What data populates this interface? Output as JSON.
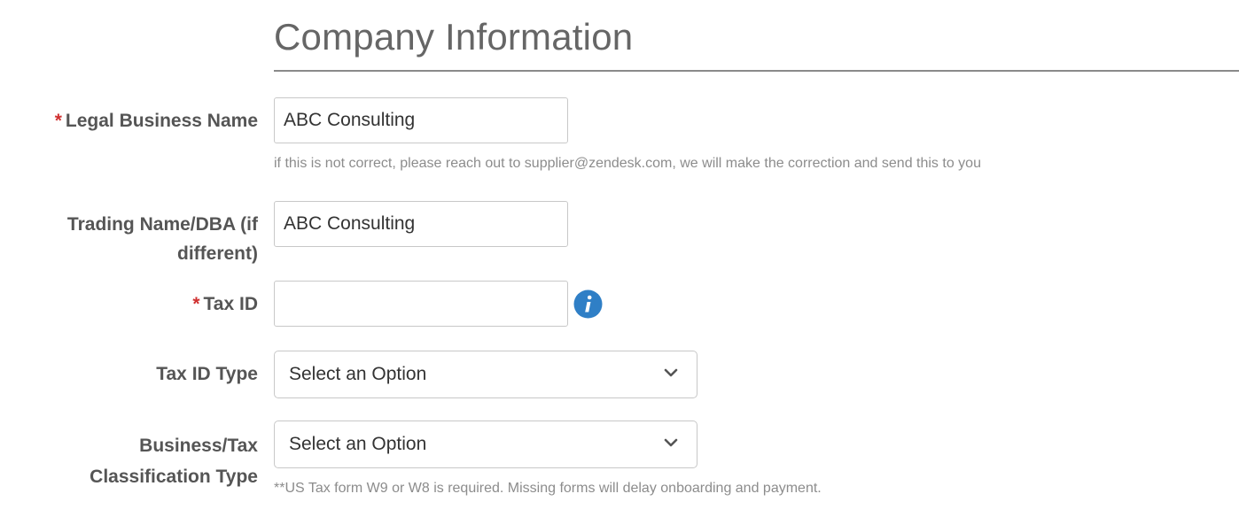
{
  "section": {
    "title": "Company Information"
  },
  "fields": {
    "legal_business_name": {
      "required_marker": "*",
      "label": "Legal Business Name",
      "value": "ABC Consulting",
      "help": "if this is not correct, please reach out to supplier@zendesk.com, we will make the correction and send this to you"
    },
    "trading_name": {
      "label_line1": "Trading Name/DBA (if",
      "label_line2": "different)",
      "value": "ABC Consulting"
    },
    "tax_id": {
      "required_marker": "*",
      "label": "Tax ID",
      "value": "",
      "info_icon": "info-icon"
    },
    "tax_id_type": {
      "label": "Tax ID Type",
      "selected": "Select an Option"
    },
    "business_tax_classification": {
      "label_line1": "Business/Tax",
      "label_line2": "Classification Type",
      "selected": "Select an Option",
      "help": "**US Tax form W9 or W8 is required. Missing forms will delay onboarding and payment."
    }
  },
  "colors": {
    "required": "#d03030",
    "info_icon": "#2f7fc6",
    "label": "#555555",
    "help_text": "#8c8c8c"
  }
}
